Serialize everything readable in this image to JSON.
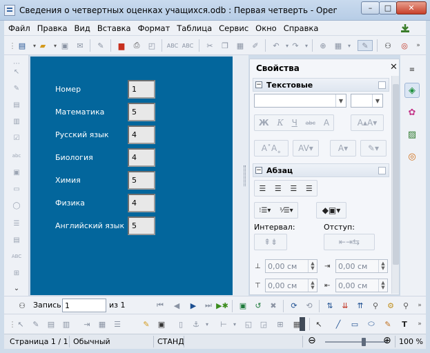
{
  "window": {
    "title": "Сведения о четвертных оценках учащихся.odb : Первая четверть - OpenOffice Base: Database F...",
    "minimize": "–",
    "maximize": "□",
    "close": "✕"
  },
  "menu": [
    "Файл",
    "Правка",
    "Вид",
    "Вставка",
    "Формат",
    "Таблица",
    "Сервис",
    "Окно",
    "Справка"
  ],
  "form": {
    "fields": [
      {
        "label": "Номер",
        "value": "1"
      },
      {
        "label": "Математика",
        "value": "5"
      },
      {
        "label": "Русский язык",
        "value": "4"
      },
      {
        "label": "Биология",
        "value": "4"
      },
      {
        "label": "Химия",
        "value": "5"
      },
      {
        "label": "Физика",
        "value": "4"
      },
      {
        "label": "Английский язык",
        "value": "5"
      }
    ],
    "background_color": "#03669c"
  },
  "sidebar": {
    "title": "Свойства",
    "close": "✕",
    "text_section": {
      "title": "Текстовые",
      "font_name": "",
      "font_size": "",
      "buttons": [
        "Ж",
        "К",
        "Ч",
        "abc",
        "A"
      ]
    },
    "paragraph_section": {
      "title": "Абзац",
      "interval_label": "Интервал:",
      "indent_label": "Отступ:",
      "spacing_above": "0,00 см",
      "spacing_below": "0,00 см",
      "indent_before": "0,00 см",
      "indent_after": "0,00 см"
    }
  },
  "navigation": {
    "record_label": "Запись",
    "record_value": "1",
    "of_label": "из 1"
  },
  "statusbar": {
    "page": "Страница 1 / 1",
    "style": "Обычный",
    "mode": "СТАНД",
    "zoom": "100 %",
    "zoom_level": 0.62
  },
  "colors": {
    "accent": "#1d4f91",
    "form_bg": "#03669c"
  }
}
